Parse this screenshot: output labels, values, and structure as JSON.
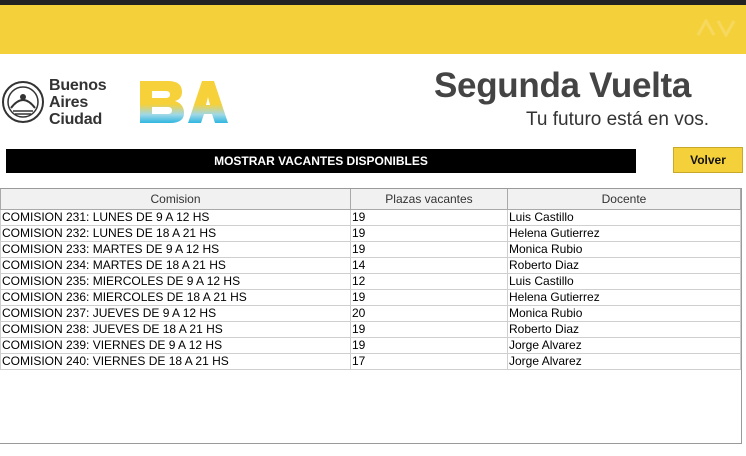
{
  "header": {
    "city": [
      "Buenos",
      "Aires",
      "Ciudad"
    ],
    "title": "Segunda Vuelta",
    "tagline": "Tu futuro está en vos."
  },
  "actions": {
    "show_label": "MOSTRAR VACANTES DISPONIBLES",
    "back_label": "Volver"
  },
  "table": {
    "columns": [
      "Comision",
      "Plazas vacantes",
      "Docente"
    ],
    "rows": [
      [
        "COMISION 231: LUNES DE 9 A 12 HS",
        "19",
        "Luis Castillo"
      ],
      [
        "COMISION 232: LUNES DE 18 A 21 HS",
        "19",
        "Helena Gutierrez"
      ],
      [
        "COMISION 233: MARTES DE 9 A 12 HS",
        "19",
        "Monica Rubio"
      ],
      [
        "COMISION 234: MARTES DE 18 A 21 HS",
        "14",
        "Roberto Diaz"
      ],
      [
        "COMISION 235: MIERCOLES DE 9 A 12 HS",
        "12",
        "Luis Castillo"
      ],
      [
        "COMISION 236: MIERCOLES DE 18 A 21 HS",
        "19",
        "Helena Gutierrez"
      ],
      [
        "COMISION 237: JUEVES DE 9 A 12 HS",
        "20",
        "Monica Rubio"
      ],
      [
        "COMISION 238: JUEVES DE 18 A 21 HS",
        "19",
        "Roberto Diaz"
      ],
      [
        "COMISION 239: VIERNES DE 9 A 12 HS",
        "19",
        "Jorge Alvarez"
      ],
      [
        "COMISION 240: VIERNES DE 18 A 21 HS",
        "17",
        "Jorge Alvarez"
      ]
    ]
  },
  "colors": {
    "brand_yellow": "#f4d03a",
    "bar_black": "#000000"
  },
  "icons": {
    "seal": "city-seal-icon",
    "logo": "ba-logo-icon"
  }
}
